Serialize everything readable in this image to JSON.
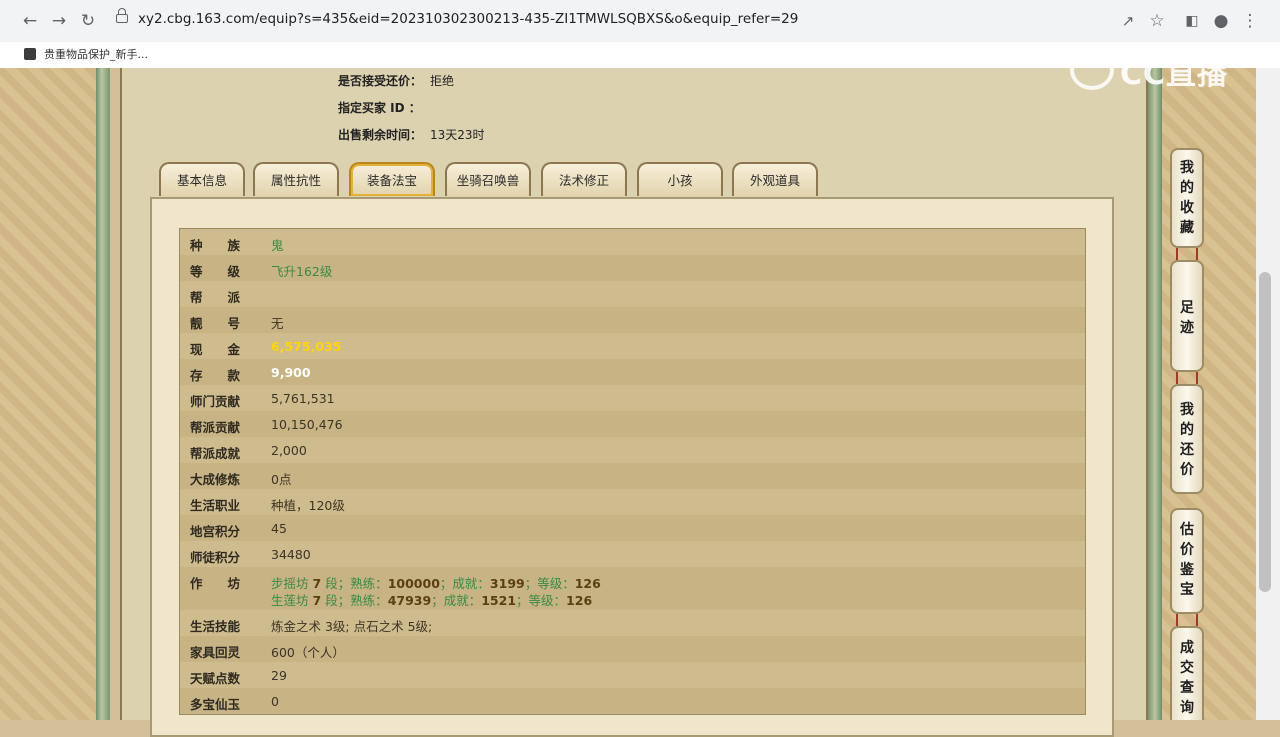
{
  "browser": {
    "url": "xy2.cbg.163.com/equip?s=435&eid=202310302300213-435-ZI1TMWLSQBXS&o&equip_refer=29",
    "bookmark": "贵重物品保护_新手..."
  },
  "watermark": "CC直播",
  "trade_info": [
    {
      "label": "是否接受还价：",
      "value": "拒绝"
    },
    {
      "label": "指定买家 ID ：",
      "value": ""
    },
    {
      "label": "出售剩余时间：",
      "value": "13天23时"
    }
  ],
  "tabs": [
    "基本信息",
    "属性抗性",
    "装备法宝",
    "坐骑召唤兽",
    "法术修正",
    "小孩",
    "外观道具"
  ],
  "active_tab": "装备法宝",
  "rows": [
    {
      "key": "种　　族",
      "value": "鬼"
    },
    {
      "key": "等　　级",
      "value": "飞升162级"
    },
    {
      "key": "帮　　派",
      "value": ""
    },
    {
      "key": "靓　　号",
      "value": "无"
    },
    {
      "key": "现　　金",
      "value": "6,575,035"
    },
    {
      "key": "存　　款",
      "value": "9,900"
    },
    {
      "key": "师门贡献",
      "value": "5,761,531"
    },
    {
      "key": "帮派贡献",
      "value": "10,150,476"
    },
    {
      "key": "帮派成就",
      "value": "2,000"
    },
    {
      "key": "大成修炼",
      "value": "0点"
    },
    {
      "key": "生活职业",
      "value": "种植，120级"
    },
    {
      "key": "地宫积分",
      "value": "45"
    },
    {
      "key": "师徒积分",
      "value": "34480"
    },
    {
      "key": "作　　坊",
      "line1": {
        "name": "步摇坊",
        "seg": "7",
        "seg_unit": "段；",
        "l_shu": "熟练：",
        "shu": "100000",
        "l_cheng": "；成就：",
        "cheng": "3199",
        "l_deng": "；等级：",
        "deng": "126"
      },
      "line2": {
        "name": "生莲坊",
        "seg": "7",
        "seg_unit": "段；",
        "l_shu": "熟练：",
        "shu": "47939",
        "l_cheng": "；成就：",
        "cheng": "1521",
        "l_deng": "；等级：",
        "deng": "126"
      }
    },
    {
      "key": "生活技能",
      "value": "炼金之术 3级; 点石之术 5级;"
    },
    {
      "key": "家具回灵",
      "value": "600（个人）"
    },
    {
      "key": "天赋点数",
      "value": "29"
    },
    {
      "key": "多宝仙玉",
      "value": "0"
    }
  ],
  "side_buttons": [
    "我的收藏",
    "足迹",
    "我的还价",
    "估价鉴宝",
    "成交查询"
  ]
}
